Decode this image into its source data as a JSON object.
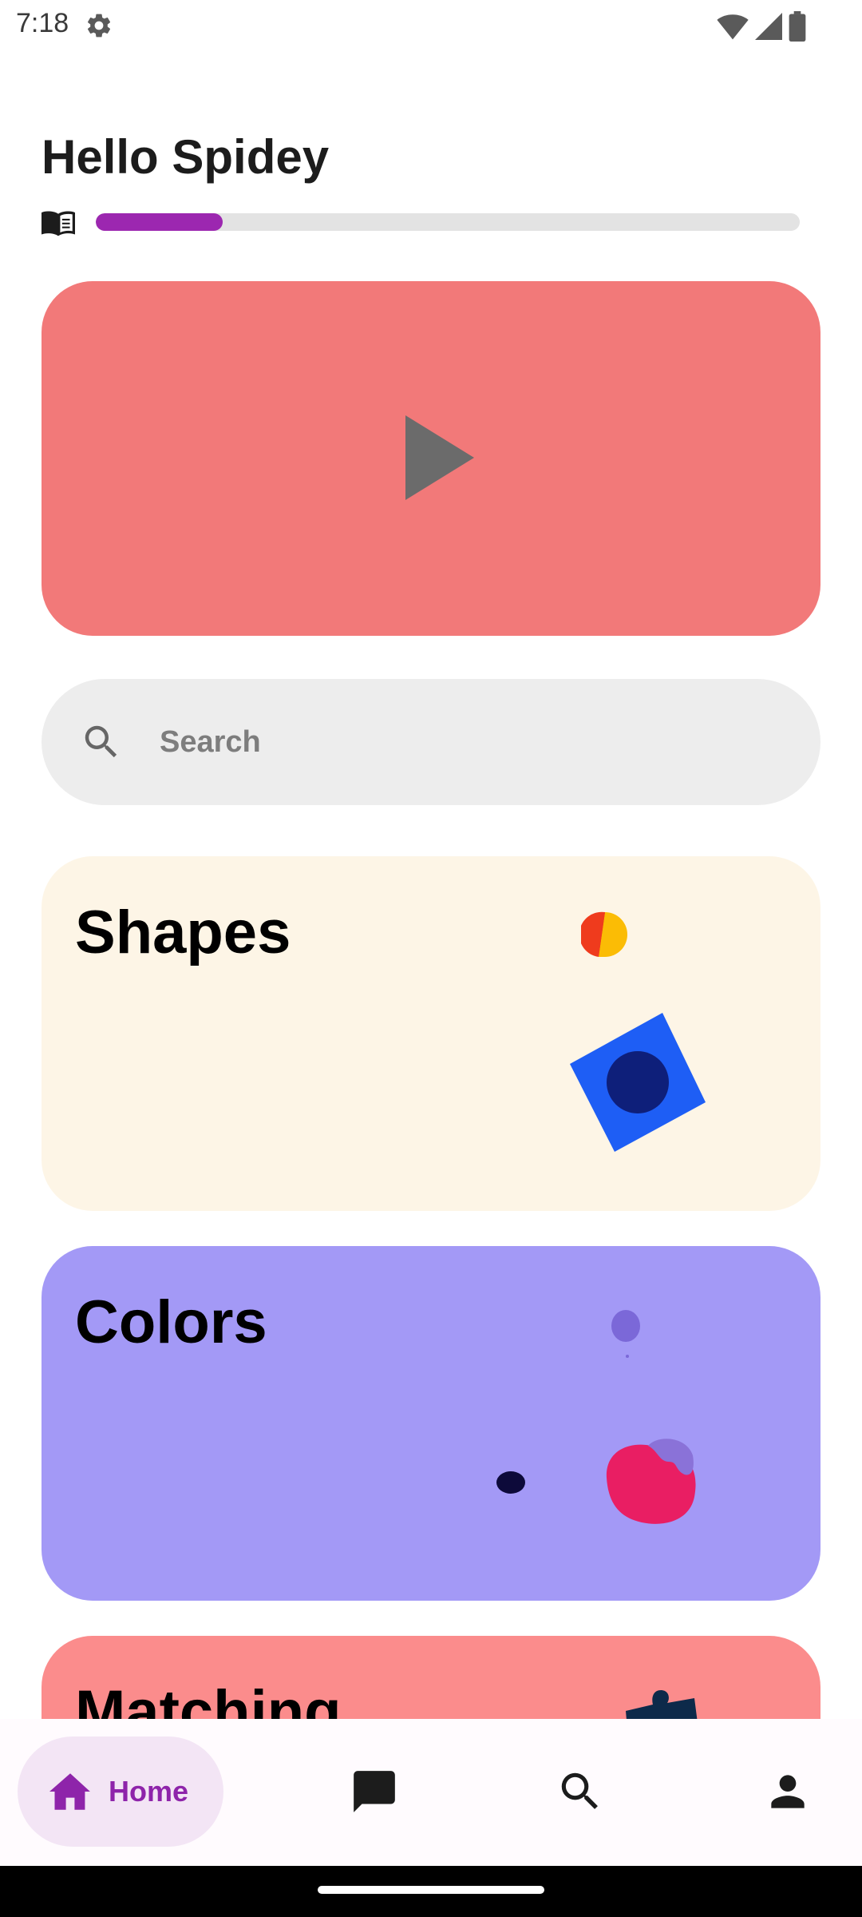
{
  "status_bar": {
    "time": "7:18"
  },
  "header": {
    "greeting": "Hello Spidey",
    "progress_fraction": 0.18
  },
  "video_card": {
    "color": "#f27979"
  },
  "search": {
    "placeholder": "Search"
  },
  "categories": [
    {
      "title": "Shapes",
      "color": "#fdf5e6"
    },
    {
      "title": "Colors",
      "color": "#a399f6"
    },
    {
      "title": "Matching",
      "color": "#fb8c8c"
    }
  ],
  "bottom_nav": {
    "items": [
      {
        "label": "Home",
        "icon": "home-icon",
        "selected": true
      },
      {
        "label": "",
        "icon": "chat-icon",
        "selected": false
      },
      {
        "label": "",
        "icon": "search-icon",
        "selected": false
      },
      {
        "label": "",
        "icon": "person-icon",
        "selected": false
      }
    ]
  },
  "colors": {
    "accent": "#9c27b0"
  }
}
